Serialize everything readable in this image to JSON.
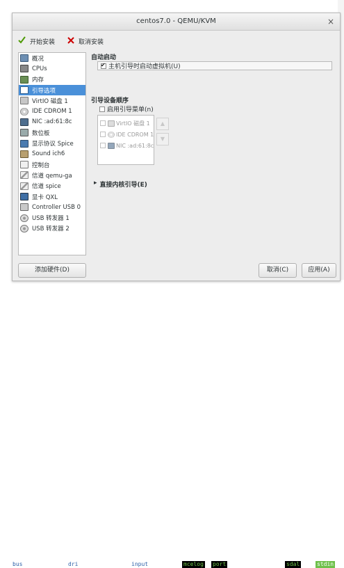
{
  "window": {
    "title": "centos7.0 - QEMU/KVM"
  },
  "toolbar": {
    "begin_install": "开始安装",
    "cancel_install": "取消安装"
  },
  "sidebar": {
    "items": [
      {
        "label": "概况",
        "icon": "monitor-icon"
      },
      {
        "label": "CPUs",
        "icon": "cpu-icon"
      },
      {
        "label": "内存",
        "icon": "memory-icon"
      },
      {
        "label": "引导选项",
        "icon": "boot-options-icon",
        "selected": true
      },
      {
        "label": "VirtIO 磁盘 1",
        "icon": "disk-icon"
      },
      {
        "label": "IDE CDROM 1",
        "icon": "cdrom-icon"
      },
      {
        "label": "NIC :ad:61:8c",
        "icon": "nic-icon"
      },
      {
        "label": "数位板",
        "icon": "tablet-icon"
      },
      {
        "label": "显示协议 Spice",
        "icon": "display-icon"
      },
      {
        "label": "Sound ich6",
        "icon": "sound-icon"
      },
      {
        "label": "控制台",
        "icon": "console-icon"
      },
      {
        "label": "信道 qemu-ga",
        "icon": "channel-icon"
      },
      {
        "label": "信道 spice",
        "icon": "channel-icon"
      },
      {
        "label": "显卡 QXL",
        "icon": "video-icon"
      },
      {
        "label": "Controller USB 0",
        "icon": "usb-controller-icon"
      },
      {
        "label": "USB 转发器 1",
        "icon": "usb-redirector-icon"
      },
      {
        "label": "USB 转发器 2",
        "icon": "usb-redirector-icon"
      }
    ],
    "add_hardware": "添加硬件(D)"
  },
  "autostart": {
    "title": "自动启动",
    "checkbox_label": "主机引导时启动虚拟机(U)",
    "checked": true
  },
  "boot_order": {
    "title": "引导设备顺序",
    "menu_label": "启用引导菜单(n)",
    "menu_checked": false,
    "devices": [
      {
        "label": "VirtIO 磁盘 1",
        "checked": false,
        "icon": "disk-icon"
      },
      {
        "label": "IDE CDROM 1",
        "checked": false,
        "icon": "cdrom-icon"
      },
      {
        "label": "NIC :ad:61:8c",
        "checked": false,
        "icon": "nic-icon"
      }
    ]
  },
  "direct_kernel": {
    "label": "直接内核引导(E)"
  },
  "footer": {
    "cancel": "取消(C)",
    "apply": "应用(A)"
  },
  "background_terminal": {
    "words": [
      "bus",
      "dri",
      "input",
      "mcelog",
      "port",
      "sdal",
      "stdin"
    ]
  },
  "colors": {
    "selection": "#4a90d9",
    "window_bg": "#ededed",
    "terminal_highlight": "#000000",
    "terminal_green": "#6ec04a"
  }
}
